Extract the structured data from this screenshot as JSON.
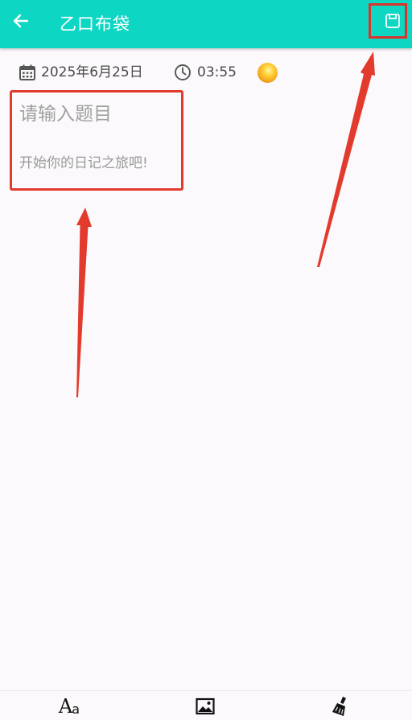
{
  "appbar": {
    "title": "乙口布袋",
    "back_icon": "arrow-left-icon",
    "save_icon": "save-icon",
    "background_color": "#0dd6c2"
  },
  "meta": {
    "date": "2025年6月25日",
    "date_icon": "calendar-icon",
    "time": "03:55",
    "time_icon": "clock-icon",
    "mood_icon": "mood-emoji-icon"
  },
  "editor": {
    "title_placeholder": "请输入题目",
    "body_placeholder": "开始你的日记之旅吧!"
  },
  "toolbar": {
    "font_label_big": "A",
    "font_label_small": "a",
    "font_icon": "font-style-icon",
    "image_icon": "image-icon",
    "clean_icon": "broom-icon"
  },
  "annotations": {
    "highlight_color": "#e23a2c"
  }
}
